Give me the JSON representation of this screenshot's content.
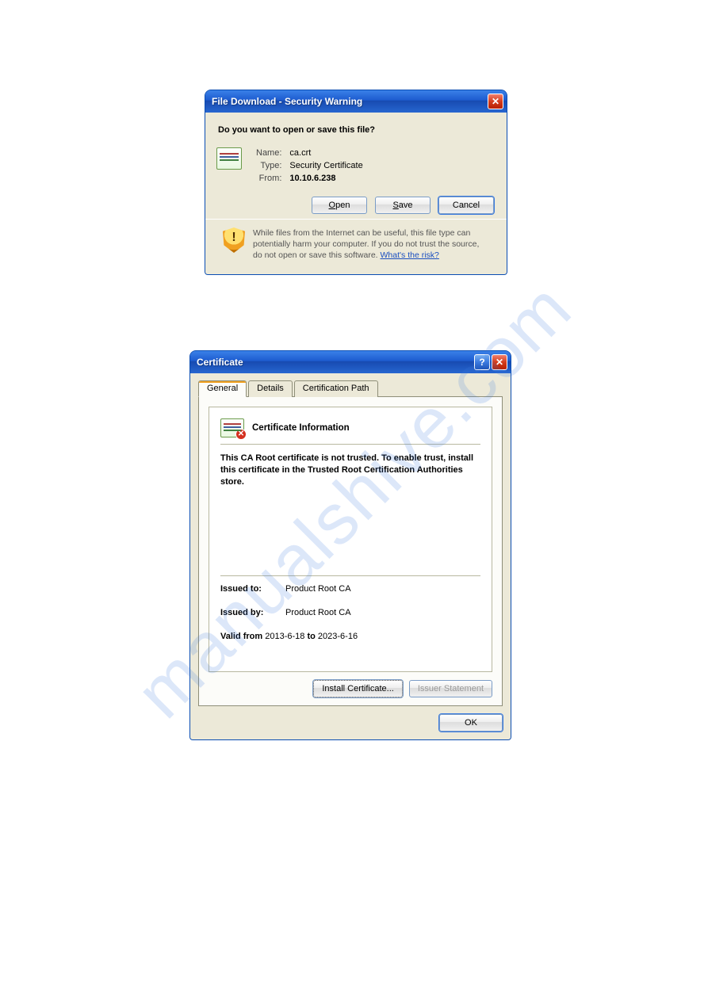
{
  "watermark": "manualshive.com",
  "file_download": {
    "title": "File Download - Security Warning",
    "heading": "Do you want to open or save this file?",
    "fields": {
      "name_label": "Name:",
      "name_value": "ca.crt",
      "type_label": "Type:",
      "type_value": "Security Certificate",
      "from_label": "From:",
      "from_value": "10.10.6.238"
    },
    "buttons": {
      "open": "Open",
      "save": "Save",
      "cancel": "Cancel"
    },
    "warning_text": "While files from the Internet can be useful, this file type can potentially harm your computer. If you do not trust the source, do not open or save this software.",
    "risk_link": "What's the risk?"
  },
  "certificate": {
    "title": "Certificate",
    "tabs": {
      "general": "General",
      "details": "Details",
      "path": "Certification Path"
    },
    "info_heading": "Certificate Information",
    "message": "This CA Root certificate is not trusted. To enable trust, install this certificate in the Trusted Root Certification Authorities store.",
    "issued_to_label": "Issued to:",
    "issued_to_value": "Product Root CA",
    "issued_by_label": "Issued by:",
    "issued_by_value": "Product Root CA",
    "valid_from_label": "Valid from",
    "valid_from_value": "2013-6-18",
    "valid_to_label": "to",
    "valid_to_value": "2023-6-16",
    "buttons": {
      "install": "Install Certificate...",
      "issuer": "Issuer Statement",
      "ok": "OK"
    }
  }
}
